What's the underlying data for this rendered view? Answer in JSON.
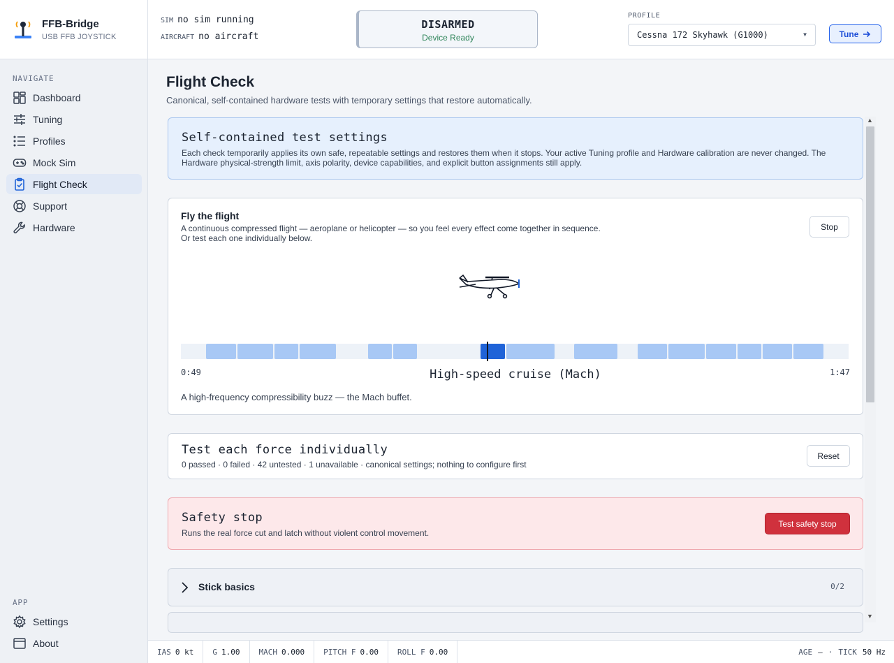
{
  "brand": {
    "name": "FFB-Bridge",
    "subtitle": "USB FFB JOYSTICK"
  },
  "nav": {
    "heading": "NAVIGATE",
    "items": [
      {
        "label": "Dashboard",
        "icon": "dashboard-icon"
      },
      {
        "label": "Tuning",
        "icon": "sliders-icon"
      },
      {
        "label": "Profiles",
        "icon": "list-icon"
      },
      {
        "label": "Mock Sim",
        "icon": "gamepad-icon"
      },
      {
        "label": "Flight Check",
        "icon": "clipboard-check-icon",
        "active": true
      },
      {
        "label": "Support",
        "icon": "lifebuoy-icon"
      },
      {
        "label": "Hardware",
        "icon": "wrench-icon"
      }
    ],
    "app_heading": "APP",
    "app_items": [
      {
        "label": "Settings",
        "icon": "gear-icon"
      },
      {
        "label": "About",
        "icon": "window-icon"
      }
    ]
  },
  "topbar": {
    "sim_key": "SIM",
    "sim_value": "no sim running",
    "aircraft_key": "AIRCRAFT",
    "aircraft_value": "no aircraft",
    "status_title": "DISARMED",
    "status_sub": "Device Ready",
    "profile_label": "PROFILE",
    "profile_value": "Cessna 172 Skyhawk (G1000)",
    "tune_label": "Tune"
  },
  "page": {
    "title": "Flight Check",
    "subtitle": "Canonical, self-contained hardware tests with temporary settings that restore automatically."
  },
  "settings_card": {
    "title": "Self-contained test settings",
    "body": "Each check temporarily applies its own safe, repeatable settings and restores them when it stops. Your active Tuning profile and Hardware calibration are never changed. The Hardware physical-strength limit, axis polarity, device capabilities, and explicit button assignments still apply."
  },
  "flight_card": {
    "title": "Fly the flight",
    "line1": "A continuous compressed flight — aeroplane or helicopter — so you feel every effect come together in sequence.",
    "line2": "Or test each one individually below.",
    "stop_label": "Stop",
    "elapsed": "0:49",
    "total": "1:47",
    "phase": "High-speed cruise (Mach)",
    "description": "A high-frequency compressibility buzz — the Mach buffet.",
    "progress_fraction": 0.458
  },
  "individual_card": {
    "title": "Test each force individually",
    "summary": "0 passed · 0 failed · 42 untested · 1 unavailable · canonical settings; nothing to configure first",
    "reset_label": "Reset"
  },
  "safety_card": {
    "title": "Safety stop",
    "body": "Runs the real force cut and latch without violent control movement.",
    "button_label": "Test safety stop"
  },
  "group": {
    "title": "Stick basics",
    "count": "0/2"
  },
  "telemetry": [
    {
      "key": "IAS",
      "value": "0 kt"
    },
    {
      "key": "G",
      "value": "1.00"
    },
    {
      "key": "MACH",
      "value": "0.000"
    },
    {
      "key": "PITCH F",
      "value": "0.00"
    },
    {
      "key": "ROLL F",
      "value": "0.00"
    }
  ],
  "status_right": {
    "age_key": "AGE",
    "age_value": "—",
    "sep": "·",
    "tick_key": "TICK",
    "tick_value": "50 Hz"
  },
  "colors": {
    "accent": "#1f63d8",
    "danger": "#d0313d",
    "info_bg": "#e6f0fd",
    "danger_bg": "#fde8ea",
    "ok": "#2f855a"
  }
}
